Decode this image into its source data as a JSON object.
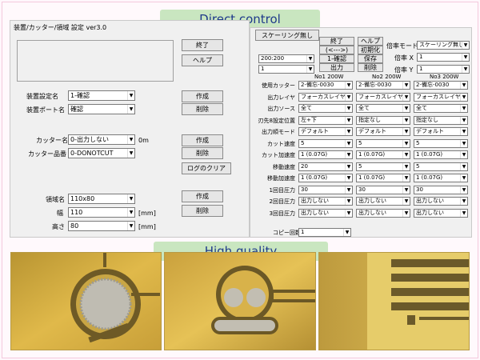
{
  "banners": {
    "top": "Direct control",
    "middle": "High quality"
  },
  "left_window": {
    "title": "装置/カッター/領域 設定 ver3.0",
    "buttons": {
      "exit": "終了",
      "help": "ヘルプ",
      "create1": "作成",
      "delete1": "削除",
      "create2": "作成",
      "delete2": "削除",
      "clear_log": "ログのクリア",
      "create3": "作成",
      "delete3": "削除"
    },
    "fields": {
      "device_settings": {
        "label": "装置設定名",
        "value": "1-確認"
      },
      "device_port": {
        "label": "装置ポート名",
        "value": "確認"
      },
      "cutter_name": {
        "label": "カッター名",
        "value": "0-出力しない",
        "unit": "0m"
      },
      "cutter_part": {
        "label": "カッター品番",
        "value": "0-DONOTCUT"
      },
      "area_name": {
        "label": "領域名",
        "value": "110x80"
      },
      "width": {
        "label": "幅",
        "value": "110",
        "unit": "[mm]"
      },
      "height": {
        "label": "高さ",
        "value": "80",
        "unit": "[mm]"
      }
    }
  },
  "right_window": {
    "scaling_button": "スケーリング無し",
    "size_value": "200:200",
    "small_value": "1",
    "buttons": {
      "exit": "終了",
      "help": "ヘルプ",
      "arrows": "(<--->)",
      "init": "初期化",
      "confirm1": "1-確認",
      "save": "保存",
      "output": "出力",
      "delete": "削除"
    },
    "scale_mode": {
      "label": "倍率モード",
      "value": "スケーリング無し"
    },
    "scale_x": {
      "label": "倍率 X",
      "value": "1"
    },
    "scale_y": {
      "label": "倍率 Y",
      "value": "1"
    },
    "column_headers": [
      "No1 200W",
      "No2 200W",
      "No3 200W"
    ],
    "rows": [
      {
        "label": "使用カッター",
        "values": [
          "2-備忘-0030",
          "2-備忘-0030",
          "2-備忘-0030"
        ]
      },
      {
        "label": "出力レイヤ",
        "values": [
          "フォーカスレイヤ",
          "フォーカスレイヤ",
          "フォーカスレイヤ"
        ]
      },
      {
        "label": "出力ソース",
        "values": [
          "全て",
          "全て",
          "全て"
        ]
      },
      {
        "label": "刃先8設定位置",
        "values": [
          "左+下",
          "指定なし",
          "指定なし"
        ]
      },
      {
        "label": "出力順モード",
        "values": [
          "デフォルト",
          "デフォルト",
          "デフォルト"
        ]
      },
      {
        "label": "カット速度",
        "values": [
          "5",
          "5",
          "5"
        ]
      },
      {
        "label": "カット加速度",
        "values": [
          "1 (0.07G)",
          "1 (0.07G)",
          "1 (0.07G)"
        ]
      },
      {
        "label": "移動速度",
        "values": [
          "20",
          "5",
          "5"
        ]
      },
      {
        "label": "移動加速度",
        "values": [
          "1 (0.07G)",
          "1 (0.07G)",
          "1 (0.07G)"
        ]
      },
      {
        "label": "1回目圧力",
        "values": [
          "30",
          "30",
          "30"
        ]
      },
      {
        "label": "2回目圧力",
        "values": [
          "出力しない",
          "出力しない",
          "出力しない"
        ]
      },
      {
        "label": "3回目圧力",
        "values": [
          "出力しない",
          "出力しない",
          "出力しない"
        ]
      }
    ],
    "copy_count": {
      "label": "コピー回数",
      "value": "1"
    }
  },
  "colors": {
    "banner_bg": "#c9e6c0",
    "banner_text": "#1f3a8a",
    "window_bg": "#f0f0f0",
    "page_bg": "#fff7fb"
  }
}
